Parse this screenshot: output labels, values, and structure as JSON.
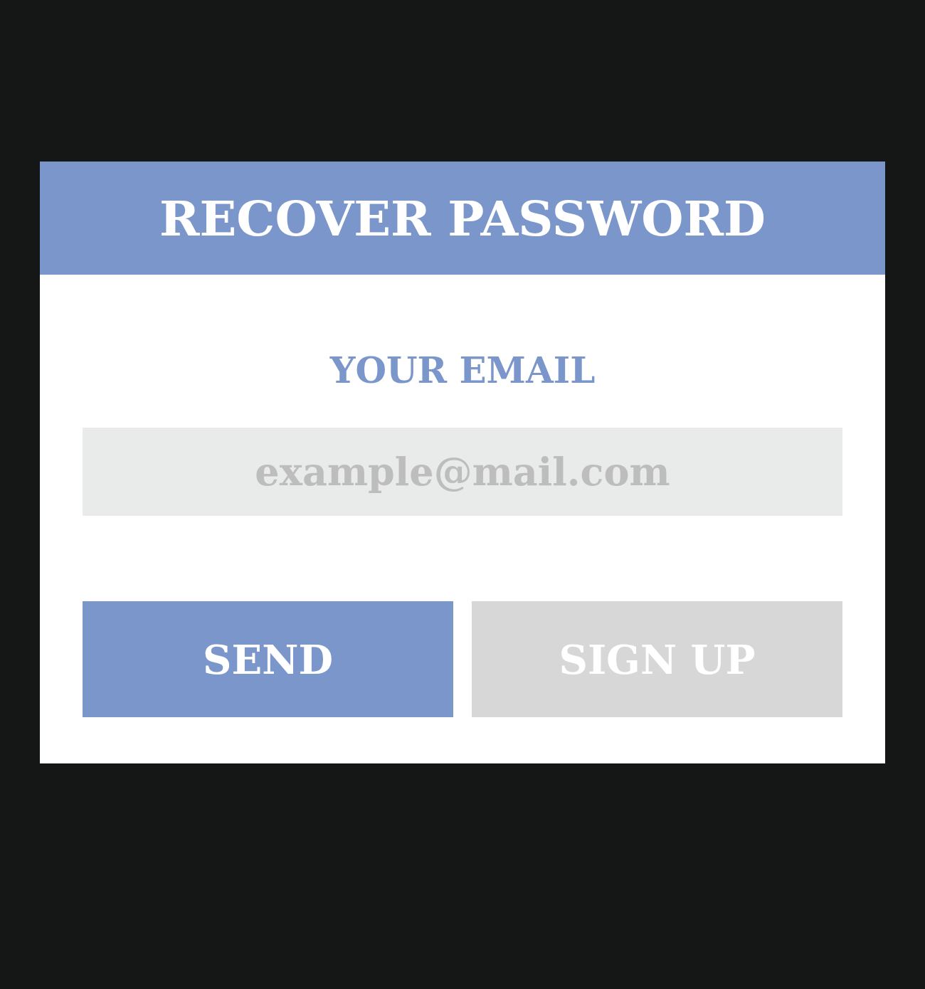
{
  "dialog": {
    "title": "RECOVER PASSWORD"
  },
  "email_field": {
    "label": "YOUR EMAIL",
    "placeholder": "example@mail.com"
  },
  "buttons": [
    {
      "label": "SEND",
      "kind": "primary"
    },
    {
      "label": "SIGN UP",
      "kind": "secondary"
    }
  ]
}
